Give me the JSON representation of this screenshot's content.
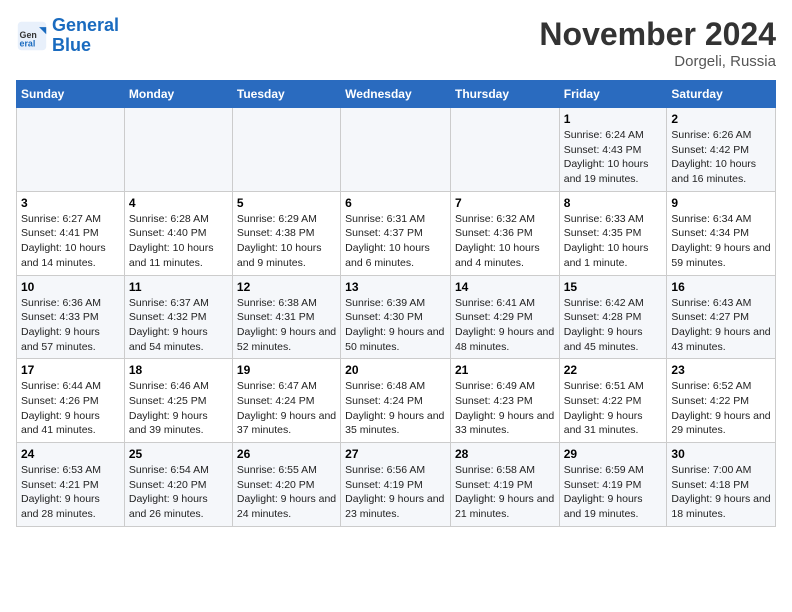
{
  "logo": {
    "text_general": "General",
    "text_blue": "Blue"
  },
  "header": {
    "title": "November 2024",
    "location": "Dorgeli, Russia"
  },
  "weekdays": [
    "Sunday",
    "Monday",
    "Tuesday",
    "Wednesday",
    "Thursday",
    "Friday",
    "Saturday"
  ],
  "weeks": [
    [
      null,
      null,
      null,
      null,
      null,
      {
        "day": "1",
        "sunrise": "6:24 AM",
        "sunset": "4:43 PM",
        "daylight": "10 hours and 19 minutes."
      },
      {
        "day": "2",
        "sunrise": "6:26 AM",
        "sunset": "4:42 PM",
        "daylight": "10 hours and 16 minutes."
      }
    ],
    [
      {
        "day": "3",
        "sunrise": "6:27 AM",
        "sunset": "4:41 PM",
        "daylight": "10 hours and 14 minutes."
      },
      {
        "day": "4",
        "sunrise": "6:28 AM",
        "sunset": "4:40 PM",
        "daylight": "10 hours and 11 minutes."
      },
      {
        "day": "5",
        "sunrise": "6:29 AM",
        "sunset": "4:38 PM",
        "daylight": "10 hours and 9 minutes."
      },
      {
        "day": "6",
        "sunrise": "6:31 AM",
        "sunset": "4:37 PM",
        "daylight": "10 hours and 6 minutes."
      },
      {
        "day": "7",
        "sunrise": "6:32 AM",
        "sunset": "4:36 PM",
        "daylight": "10 hours and 4 minutes."
      },
      {
        "day": "8",
        "sunrise": "6:33 AM",
        "sunset": "4:35 PM",
        "daylight": "10 hours and 1 minute."
      },
      {
        "day": "9",
        "sunrise": "6:34 AM",
        "sunset": "4:34 PM",
        "daylight": "9 hours and 59 minutes."
      }
    ],
    [
      {
        "day": "10",
        "sunrise": "6:36 AM",
        "sunset": "4:33 PM",
        "daylight": "9 hours and 57 minutes."
      },
      {
        "day": "11",
        "sunrise": "6:37 AM",
        "sunset": "4:32 PM",
        "daylight": "9 hours and 54 minutes."
      },
      {
        "day": "12",
        "sunrise": "6:38 AM",
        "sunset": "4:31 PM",
        "daylight": "9 hours and 52 minutes."
      },
      {
        "day": "13",
        "sunrise": "6:39 AM",
        "sunset": "4:30 PM",
        "daylight": "9 hours and 50 minutes."
      },
      {
        "day": "14",
        "sunrise": "6:41 AM",
        "sunset": "4:29 PM",
        "daylight": "9 hours and 48 minutes."
      },
      {
        "day": "15",
        "sunrise": "6:42 AM",
        "sunset": "4:28 PM",
        "daylight": "9 hours and 45 minutes."
      },
      {
        "day": "16",
        "sunrise": "6:43 AM",
        "sunset": "4:27 PM",
        "daylight": "9 hours and 43 minutes."
      }
    ],
    [
      {
        "day": "17",
        "sunrise": "6:44 AM",
        "sunset": "4:26 PM",
        "daylight": "9 hours and 41 minutes."
      },
      {
        "day": "18",
        "sunrise": "6:46 AM",
        "sunset": "4:25 PM",
        "daylight": "9 hours and 39 minutes."
      },
      {
        "day": "19",
        "sunrise": "6:47 AM",
        "sunset": "4:24 PM",
        "daylight": "9 hours and 37 minutes."
      },
      {
        "day": "20",
        "sunrise": "6:48 AM",
        "sunset": "4:24 PM",
        "daylight": "9 hours and 35 minutes."
      },
      {
        "day": "21",
        "sunrise": "6:49 AM",
        "sunset": "4:23 PM",
        "daylight": "9 hours and 33 minutes."
      },
      {
        "day": "22",
        "sunrise": "6:51 AM",
        "sunset": "4:22 PM",
        "daylight": "9 hours and 31 minutes."
      },
      {
        "day": "23",
        "sunrise": "6:52 AM",
        "sunset": "4:22 PM",
        "daylight": "9 hours and 29 minutes."
      }
    ],
    [
      {
        "day": "24",
        "sunrise": "6:53 AM",
        "sunset": "4:21 PM",
        "daylight": "9 hours and 28 minutes."
      },
      {
        "day": "25",
        "sunrise": "6:54 AM",
        "sunset": "4:20 PM",
        "daylight": "9 hours and 26 minutes."
      },
      {
        "day": "26",
        "sunrise": "6:55 AM",
        "sunset": "4:20 PM",
        "daylight": "9 hours and 24 minutes."
      },
      {
        "day": "27",
        "sunrise": "6:56 AM",
        "sunset": "4:19 PM",
        "daylight": "9 hours and 23 minutes."
      },
      {
        "day": "28",
        "sunrise": "6:58 AM",
        "sunset": "4:19 PM",
        "daylight": "9 hours and 21 minutes."
      },
      {
        "day": "29",
        "sunrise": "6:59 AM",
        "sunset": "4:19 PM",
        "daylight": "9 hours and 19 minutes."
      },
      {
        "day": "30",
        "sunrise": "7:00 AM",
        "sunset": "4:18 PM",
        "daylight": "9 hours and 18 minutes."
      }
    ]
  ],
  "labels": {
    "sunrise": "Sunrise:",
    "sunset": "Sunset:",
    "daylight": "Daylight:"
  }
}
